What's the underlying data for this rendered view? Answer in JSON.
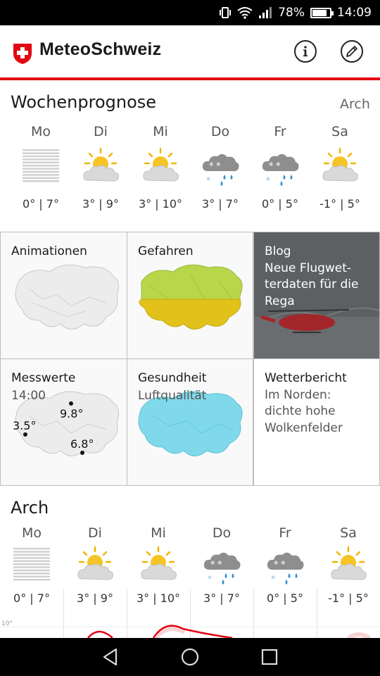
{
  "status": {
    "battery": "78%",
    "time": "14:09"
  },
  "app": {
    "title": "MeteoSchweiz"
  },
  "weekly": {
    "title": "Wochenprognose",
    "location": "Arch",
    "days": [
      {
        "name": "Mo",
        "icon": "fog-icon",
        "temp": "0° | 7°"
      },
      {
        "name": "Di",
        "icon": "partly-cloudy-icon",
        "temp": "3° | 9°"
      },
      {
        "name": "Mi",
        "icon": "partly-cloudy-icon",
        "temp": "3° | 10°"
      },
      {
        "name": "Do",
        "icon": "rain-snow-icon",
        "temp": "3° | 7°"
      },
      {
        "name": "Fr",
        "icon": "rain-snow-icon",
        "temp": "0° | 5°"
      },
      {
        "name": "Sa",
        "icon": "partly-cloudy-icon",
        "temp": "-1° | 5°"
      }
    ]
  },
  "tiles": {
    "animationen": "Animationen",
    "gefahren": "Gefahren",
    "blog_label": "Blog",
    "blog_title": "Neue Flugwet-terdaten für die Rega",
    "blog_lines": [
      "Neue Flugwet-",
      "terdaten für die",
      "Rega"
    ],
    "messwerte": "Messwerte",
    "messwerte_time": "14:00",
    "messwerte_values": [
      "9.8°",
      "3.5°",
      "6.8°"
    ],
    "gesundheit": "Gesundheit",
    "gesundheit_sub": "Luftqualität",
    "wetterbericht": "Wetterbericht",
    "wetterbericht_lines": [
      "Im Norden:",
      "dichte hohe",
      "Wolkenfelder"
    ]
  },
  "local": {
    "title": "Arch",
    "days": [
      {
        "name": "Mo",
        "icon": "fog-icon",
        "temp": "0° | 7°"
      },
      {
        "name": "Di",
        "icon": "partly-cloudy-icon",
        "temp": "3° | 9°"
      },
      {
        "name": "Mi",
        "icon": "partly-cloudy-icon",
        "temp": "3° | 10°"
      },
      {
        "name": "Do",
        "icon": "rain-snow-icon",
        "temp": "3° | 7°"
      },
      {
        "name": "Fr",
        "icon": "rain-snow-icon",
        "temp": "0° | 5°"
      },
      {
        "name": "Sa",
        "icon": "partly-cloudy-icon",
        "temp": "-1° | 5°"
      }
    ],
    "chart_tick": "10°"
  },
  "colors": {
    "brand_red": "#e30613",
    "hazard_green": "#b8d64a",
    "hazard_yellow": "#e2c21a",
    "air_cyan": "#7fd9ea"
  }
}
